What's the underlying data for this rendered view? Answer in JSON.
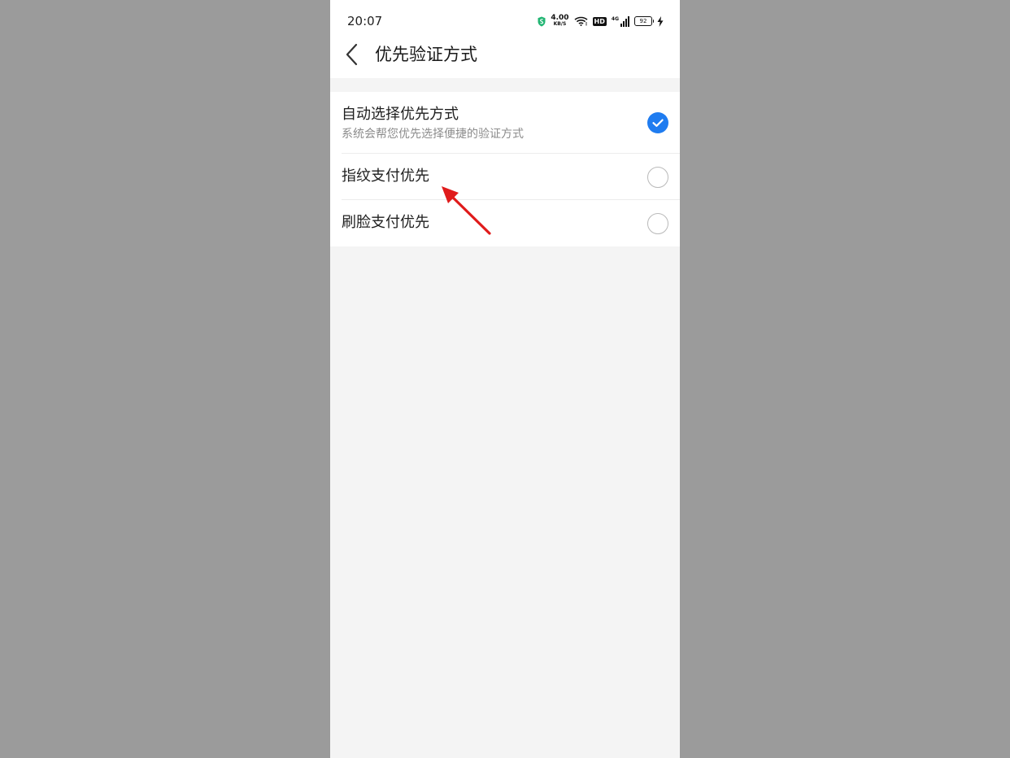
{
  "status_bar": {
    "time": "20:07",
    "net_speed_value": "4.00",
    "net_speed_unit": "KB/S",
    "hd_label": "HD",
    "network_type": "4G",
    "battery_level": "92",
    "icons": [
      "shield-icon",
      "wifi-icon",
      "signal-icon",
      "battery-icon",
      "charging-icon"
    ]
  },
  "header": {
    "back_icon": "chevron-left-icon",
    "title": "优先验证方式"
  },
  "options": [
    {
      "title": "自动选择优先方式",
      "subtitle": "系统会帮您优先选择便捷的验证方式",
      "selected": true
    },
    {
      "title": "指纹支付优先",
      "selected": false
    },
    {
      "title": "刷脸支付优先",
      "selected": false
    }
  ],
  "colors": {
    "accent": "#1f7cf0",
    "annotation_arrow": "#e01b1b",
    "backdrop": "#9b9b9b",
    "page_bg": "#f4f4f4"
  }
}
